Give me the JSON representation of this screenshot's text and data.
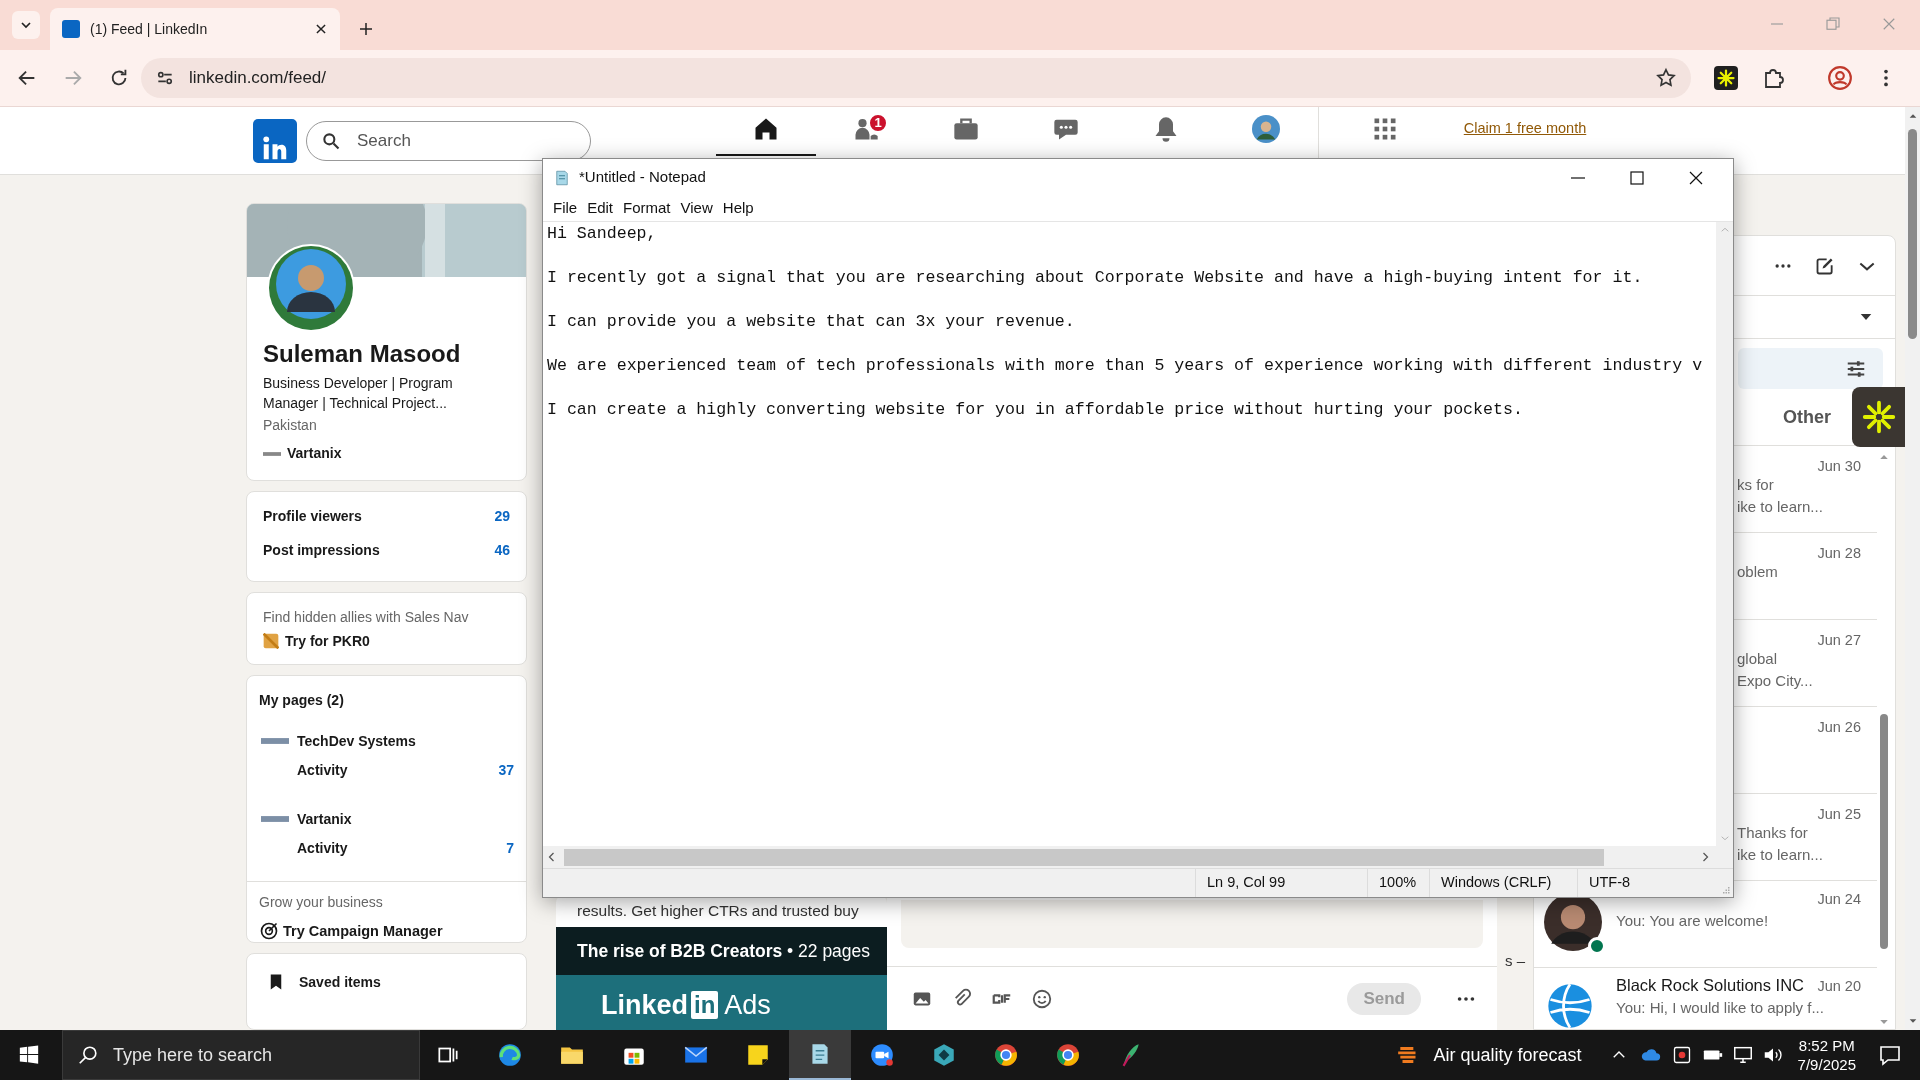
{
  "browser": {
    "tab": {
      "title": "(1) Feed | LinkedIn"
    },
    "url": "linkedin.com/feed/"
  },
  "header": {
    "search": {
      "placeholder": "Search"
    },
    "nav": [
      {
        "kind": "home",
        "selected": true
      },
      {
        "kind": "network",
        "badge": "1",
        "selected": false
      },
      {
        "kind": "jobs",
        "selected": false
      },
      {
        "kind": "messaging",
        "selected": false
      },
      {
        "kind": "notifications",
        "selected": false
      },
      {
        "kind": "me",
        "selected": false
      },
      {
        "kind": "business",
        "selected": false
      }
    ],
    "premium": "Claim 1 free month"
  },
  "profile": {
    "name": "Suleman Masood",
    "headline": "Business Developer | Program Manager | Technical Project...",
    "location": "Pakistan",
    "company": "Vartanix"
  },
  "stats": [
    {
      "label": "Profile viewers",
      "value": "29"
    },
    {
      "label": "Post impressions",
      "value": "46"
    }
  ],
  "sales_nav": {
    "text": "Find hidden allies with Sales Nav",
    "cta": "Try for PKR0"
  },
  "pages": {
    "title": "My pages (2)",
    "items": [
      {
        "name": "TechDev Systems",
        "label": "Activity",
        "value": "37"
      },
      {
        "name": "Vartanix",
        "label": "Activity",
        "value": "7"
      }
    ],
    "grow": "Grow your business",
    "cta": "Try Campaign Manager"
  },
  "saved": "Saved items",
  "ad": {
    "text": "results. Get higher CTRs and trusted buy",
    "band_title": "The rise of B2B Creators",
    "band_suffix": "• 22 pages",
    "logo_word": "Linked",
    "logo_box": "in",
    "logo_suffix": "Ads"
  },
  "composer": {
    "send": "Send",
    "edge_text": "s –"
  },
  "messaging": {
    "tab": {
      "label": "Other",
      "selected": false
    },
    "items": [
      {
        "kind": "covered",
        "date": "Jun 30",
        "lines": [
          "ks for",
          "ike to learn..."
        ]
      },
      {
        "kind": "covered",
        "date": "Jun 28",
        "lines": [
          "oblem"
        ]
      },
      {
        "kind": "covered",
        "date": "Jun 27",
        "lines": [
          "global",
          "Expo City..."
        ]
      },
      {
        "kind": "covered",
        "date": "Jun 26"
      },
      {
        "kind": "covered",
        "date": "Jun 25",
        "lines": [
          "Thanks for",
          "ike to learn..."
        ]
      },
      {
        "kind": "person",
        "preview": "You: You are welcome!",
        "date": "Jun 24",
        "online": true
      },
      {
        "kind": "company",
        "name": "Black Rock Solutions INC",
        "preview": "You: Hi, I would like to apply f...",
        "date": "Jun 20",
        "online": false
      }
    ]
  },
  "notepad": {
    "title": "*Untitled - Notepad",
    "menu": [
      "File",
      "Edit",
      "Format",
      "View",
      "Help"
    ],
    "paragraphs": [
      "Hi Sandeep,",
      "I recently got a signal that you are researching about Corporate Website and have a high-buying intent for it.",
      "I can provide you a website that can 3x your revenue.",
      "We are experienced team of tech professionals with more than 5 years of experience working with different industry v",
      "I can create a highly converting website for you in affordable price without hurting your pockets."
    ],
    "status": [
      "Ln 9, Col 99",
      "100%",
      "Windows (CRLF)",
      "UTF-8"
    ]
  },
  "taskbar": {
    "search_placeholder": "Type here to search",
    "apps": [
      {
        "kind": "taskview",
        "selected": false
      },
      {
        "kind": "edge",
        "selected": false
      },
      {
        "kind": "explorer",
        "selected": false
      },
      {
        "kind": "store",
        "selected": false
      },
      {
        "kind": "mail",
        "selected": false
      },
      {
        "kind": "sticky",
        "selected": false
      },
      {
        "kind": "notepad",
        "selected": true
      },
      {
        "kind": "zoom",
        "selected": false
      },
      {
        "kind": "cube",
        "selected": false
      },
      {
        "kind": "chrome",
        "selected": false
      },
      {
        "kind": "chrome",
        "selected": false
      },
      {
        "kind": "feather",
        "selected": false
      }
    ],
    "weather": "Air quality forecast",
    "time": "8:52 PM",
    "date": "7/9/2025"
  }
}
